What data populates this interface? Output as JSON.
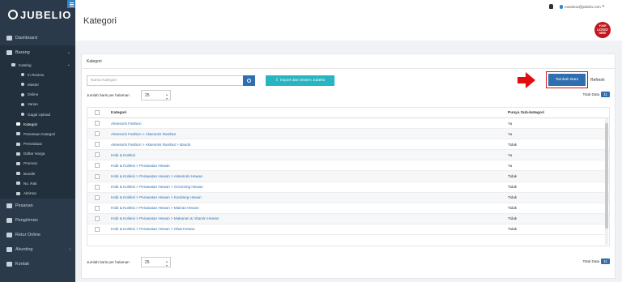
{
  "brand": {
    "name": "JUBELIO"
  },
  "sidebar": {
    "items": [
      {
        "label": "Dashboard",
        "icon": "dashboard-icon"
      },
      {
        "label": "Barang",
        "icon": "tags-icon"
      }
    ],
    "katalog": {
      "label": "Katalog",
      "icon": "grid-icon"
    },
    "katalog_sub": [
      {
        "label": "In Review"
      },
      {
        "label": "Master"
      },
      {
        "label": "Online"
      },
      {
        "label": "Varian"
      },
      {
        "label": "Gagal Upload"
      }
    ],
    "barang_sub": [
      {
        "label": "Kategori",
        "icon": "triangle-icon"
      },
      {
        "label": "Pemetaan Kategori",
        "icon": "map-icon"
      },
      {
        "label": "Persediaan",
        "icon": "cubes-icon"
      },
      {
        "label": "Daftar Harga",
        "icon": "dollar-icon"
      },
      {
        "label": "Promosi",
        "icon": "percent-icon"
      },
      {
        "label": "Bundle",
        "icon": "bundle-icon"
      },
      {
        "label": "No. Rak",
        "icon": "shelf-icon"
      },
      {
        "label": "AktiHas",
        "icon": "history-icon"
      }
    ],
    "bottom": [
      {
        "label": "Pesanan",
        "icon": "cart-icon"
      },
      {
        "label": "Pengiriman",
        "icon": "truck-icon"
      },
      {
        "label": "Retur Online",
        "icon": "return-icon"
      },
      {
        "label": "Akunting",
        "icon": "accounting-icon"
      },
      {
        "label": "Kontak",
        "icon": "contact-icon"
      }
    ]
  },
  "header": {
    "title": "Kategori",
    "user_email": "euseboo@jubelio.com",
    "logo_lines": [
      "YOUR",
      "LOGO",
      "HERE"
    ]
  },
  "card": {
    "title": "Kategori",
    "search_placeholder": "Nama Kategori",
    "import_label": "Import dari Sistem Jubelio",
    "add_label": "Tambah Baru",
    "refresh_label": "Refresh",
    "rows_label": "Jumlah baris per halaman",
    "rows_value": "25",
    "total_label": "Total Data",
    "total_value": "11"
  },
  "table": {
    "headers": [
      "Kategori",
      "Punya Sub-kategori"
    ],
    "rows": [
      {
        "name": "Aksesoris Fashion",
        "has_sub": "Ya"
      },
      {
        "name": "Aksesoris Fashion > Aksesoris Rambut",
        "has_sub": "Ya"
      },
      {
        "name": "Aksesoris Fashion > Aksesoris Rambut > Bando",
        "has_sub": "Tidak"
      },
      {
        "name": "Hobi & Koleksi",
        "has_sub": "Ya"
      },
      {
        "name": "Hobi & Koleksi > Perawatan Hewan",
        "has_sub": "Ya"
      },
      {
        "name": "Hobi & Koleksi > Perawatan Hewan > Aksesoris Hewan",
        "has_sub": "Tidak"
      },
      {
        "name": "Hobi & Koleksi > Perawatan Hewan > Grooming Hewan",
        "has_sub": "Tidak"
      },
      {
        "name": "Hobi & Koleksi > Perawatan Hewan > Kandang Hewan",
        "has_sub": "Tidak"
      },
      {
        "name": "Hobi & Koleksi > Perawatan Hewan > Mainan Hewan",
        "has_sub": "Tidak"
      },
      {
        "name": "Hobi & Koleksi > Perawatan Hewan > Makanan & Vitamin Hewan",
        "has_sub": "Tidak"
      },
      {
        "name": "Hobi & Koleksi > Perawatan Hewan > Obat Hewan",
        "has_sub": "Tidak"
      }
    ]
  },
  "colors": {
    "sidebar": "#2b3a4a",
    "primary": "#2f6fb0",
    "import": "#27b5c4",
    "highlight": "#e30c0c"
  }
}
